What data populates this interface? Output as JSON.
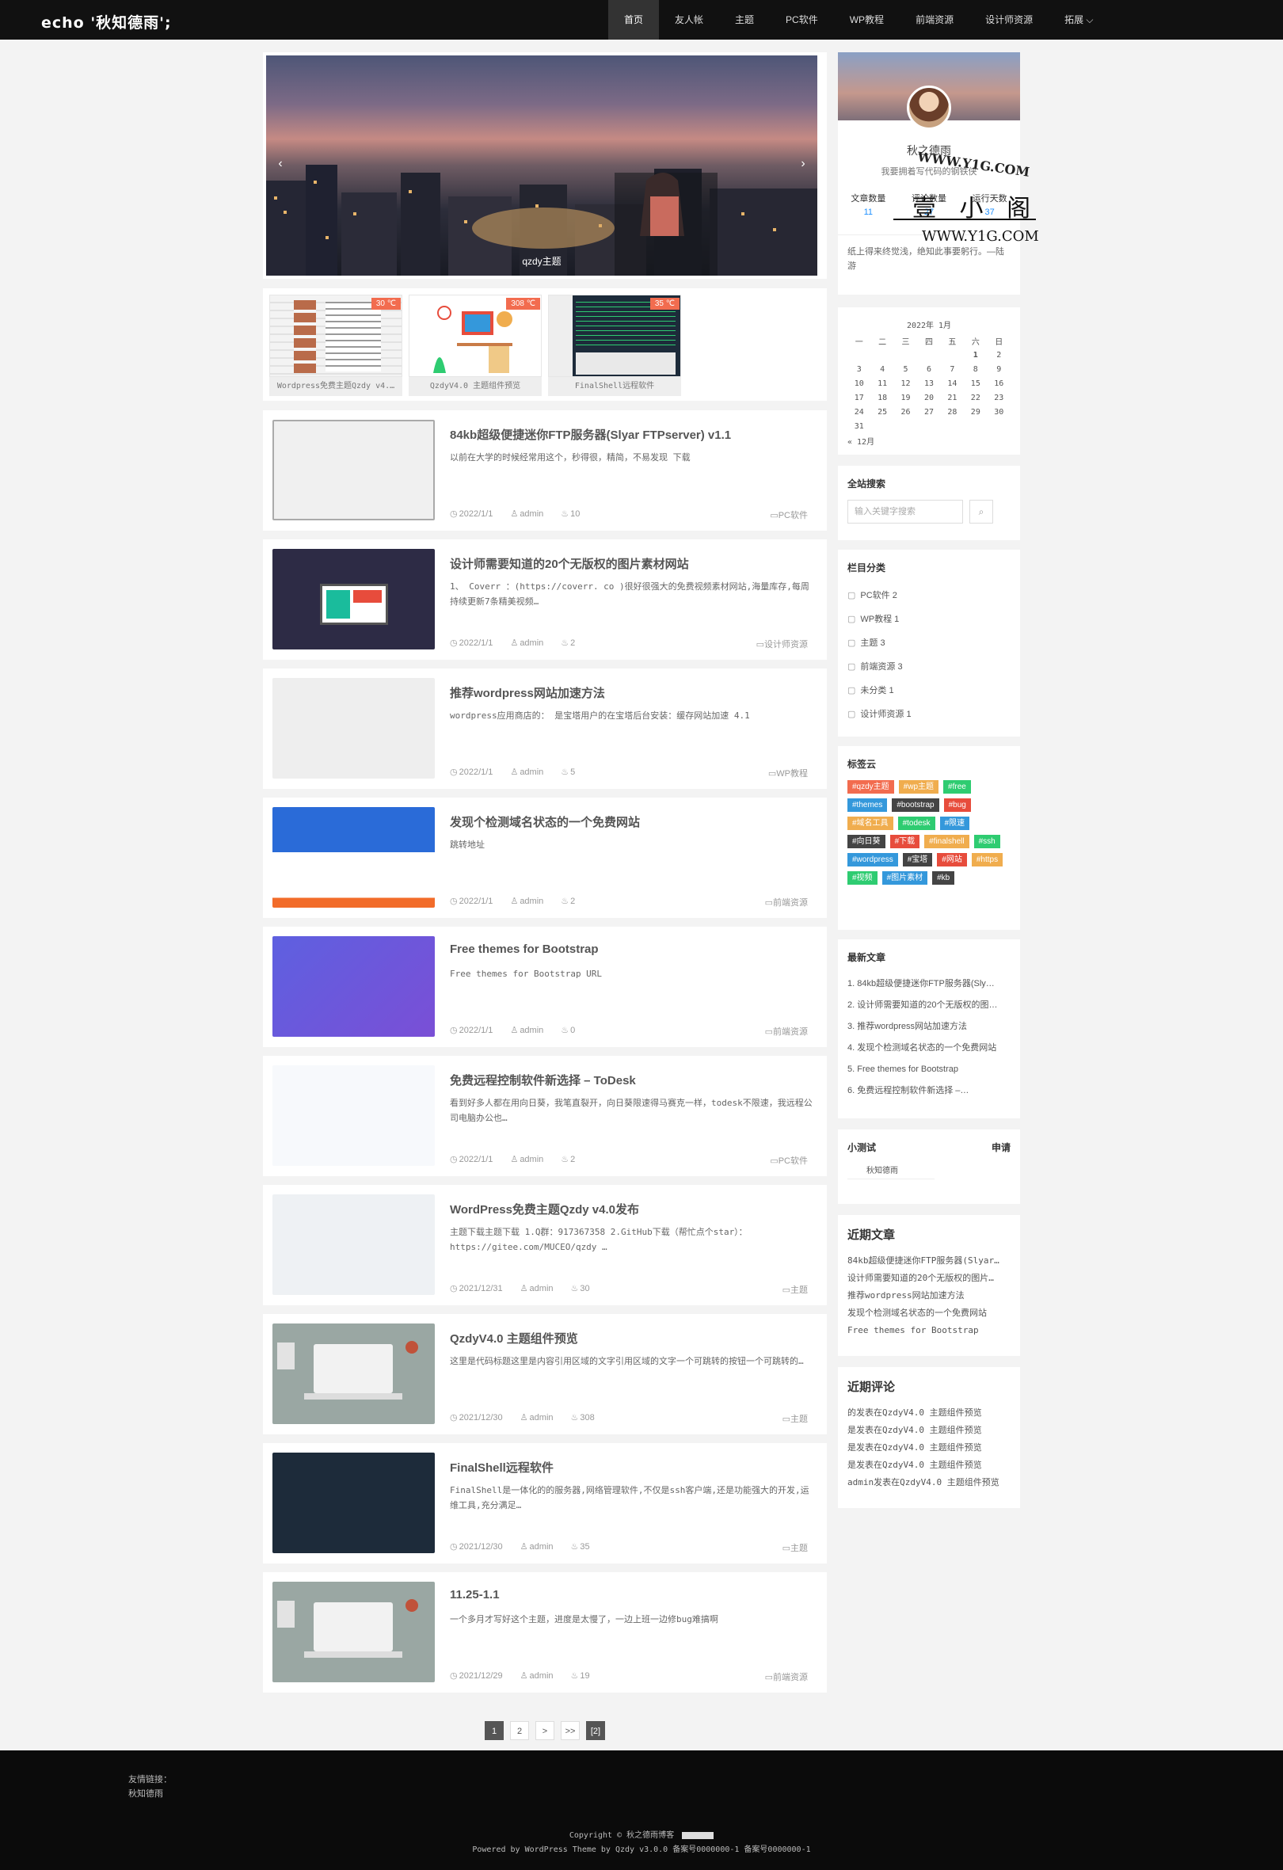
{
  "nav": {
    "logo": "echo '秋知德雨';",
    "items": [
      "首页",
      "友人帐",
      "主题",
      "PC软件",
      "WP教程",
      "前端资源",
      "设计师资源",
      "拓展 ⌵"
    ]
  },
  "slider": {
    "caption": "qzdy主题",
    "prev": "‹",
    "next": "›"
  },
  "thumbs": [
    {
      "label": "Wordpress免费主题Qzdy v4.…",
      "temp": "30 ℃"
    },
    {
      "label": "QzdyV4.0 主题组件预览",
      "temp": "308 ℃"
    },
    {
      "label": "FinalShell远程软件",
      "temp": "35 ℃"
    }
  ],
  "posts": [
    {
      "title": "84kb超级便捷迷你FTP服务器(Slyar FTPserver) v1.1",
      "excerpt": "以前在大学的时候经常用这个，秒得很，精简，不易发现  下载",
      "date": "2022/1/1",
      "author": "admin",
      "views": "10",
      "cat": "PC软件"
    },
    {
      "title": "设计师需要知道的20个无版权的图片素材网站",
      "excerpt": "1、 Coverr ：(https://coverr. co )很好很强大的免费视频素材网站,海量库存,每周持续更新7条精美视频…",
      "date": "2022/1/1",
      "author": "admin",
      "views": "2",
      "cat": "设计师资源"
    },
    {
      "title": "推荐wordpress网站加速方法",
      "excerpt": "wordpress应用商店的：   是宝塔用户的在宝塔后台安装：缓存网站加速 4.1",
      "date": "2022/1/1",
      "author": "admin",
      "views": "5",
      "cat": "WP教程"
    },
    {
      "title": "发现个检测域名状态的一个免费网站",
      "excerpt": "跳转地址",
      "date": "2022/1/1",
      "author": "admin",
      "views": "2",
      "cat": "前端资源"
    },
    {
      "title": "Free themes for Bootstrap",
      "excerpt": "Free themes for Bootstrap URL",
      "date": "2022/1/1",
      "author": "admin",
      "views": "0",
      "cat": "前端资源"
    },
    {
      "title": "免费远程控制软件新选择 – ToDesk",
      "excerpt": "看到好多人都在用向日葵，我笔直裂开，向日葵限速得马赛克一样，todesk不限速，我远程公司电脑办公也…",
      "date": "2022/1/1",
      "author": "admin",
      "views": "2",
      "cat": "PC软件"
    },
    {
      "title": "WordPress免费主题Qzdy v4.0发布",
      "excerpt": "主题下载主题下载 1.Q群：917367358 2.GitHub下载（帮忙点个star）：https://gitee.com/MUCEO/qzdy …",
      "date": "2021/12/31",
      "author": "admin",
      "views": "30",
      "cat": "主题"
    },
    {
      "title": "QzdyV4.0 主题组件预览",
      "excerpt": "这里是代码标题这里是内容引用区域的文字引用区域的文字一个可跳转的按钮一个可跳转的…",
      "date": "2021/12/30",
      "author": "admin",
      "views": "308",
      "cat": "主题"
    },
    {
      "title": "FinalShell远程软件",
      "excerpt": "FinalShell是一体化的的服务器,网络管理软件,不仅是ssh客户端,还是功能强大的开发,运维工具,充分满足…",
      "date": "2021/12/30",
      "author": "admin",
      "views": "35",
      "cat": "主题"
    },
    {
      "title": "11.25-1.1",
      "excerpt": "一个多月才写好这个主题，进度是太慢了，一边上班一边修bug难搞啊",
      "date": "2021/12/29",
      "author": "admin",
      "views": "19",
      "cat": "前端资源"
    }
  ],
  "pager": [
    "1",
    "2",
    ">",
    ">>",
    "[2]"
  ],
  "profile": {
    "name": "秋之德雨",
    "desc": "我要拥着写代码的钢铁侠",
    "stats": [
      {
        "label": "文章数量",
        "value": "11"
      },
      {
        "label": "评论数量",
        "value": "27"
      },
      {
        "label": "运行天数",
        "value": "37"
      }
    ]
  },
  "quote": "纸上得来终觉浅，绝知此事要躬行。—陆游",
  "calendar": {
    "caption": "2022年 1月",
    "head": [
      "一",
      "二",
      "三",
      "四",
      "五",
      "六",
      "日"
    ],
    "rows": [
      [
        "",
        "",
        "",
        "",
        "",
        "1",
        "2"
      ],
      [
        "3",
        "4",
        "5",
        "6",
        "7",
        "8",
        "9"
      ],
      [
        "10",
        "11",
        "12",
        "13",
        "14",
        "15",
        "16"
      ],
      [
        "17",
        "18",
        "19",
        "20",
        "21",
        "22",
        "23"
      ],
      [
        "24",
        "25",
        "26",
        "27",
        "28",
        "29",
        "30"
      ],
      [
        "31",
        "",
        "",
        "",
        "",
        "",
        ""
      ]
    ],
    "prev": "« 12月"
  },
  "search": {
    "title": "全站搜索",
    "placeholder": "输入关键字搜索",
    "btn": "⌕"
  },
  "categories": {
    "title": "栏目分类",
    "items": [
      "PC软件 2",
      "WP教程 1",
      "主题 3",
      "前端资源 3",
      "未分类 1",
      "设计师资源 1"
    ]
  },
  "tagcloud": {
    "title": "标签云",
    "tags": [
      {
        "t": "#qzdy主题",
        "c": "#f26c4f"
      },
      {
        "t": "#wp主题",
        "c": "#f0ad4e"
      },
      {
        "t": "#free",
        "c": "#2ecc71"
      },
      {
        "t": "#themes",
        "c": "#3498db"
      },
      {
        "t": "#bootstrap",
        "c": "#444444"
      },
      {
        "t": "#bug",
        "c": "#e74c3c"
      },
      {
        "t": "#域名工具",
        "c": "#f0ad4e"
      },
      {
        "t": "#todesk",
        "c": "#2ecc71"
      },
      {
        "t": "#限速",
        "c": "#3498db"
      },
      {
        "t": "#向日葵",
        "c": "#444444"
      },
      {
        "t": "#下载",
        "c": "#e74c3c"
      },
      {
        "t": "#finalshell",
        "c": "#f0ad4e"
      },
      {
        "t": "#ssh",
        "c": "#2ecc71"
      },
      {
        "t": "#wordpress",
        "c": "#3498db"
      },
      {
        "t": "#宝塔",
        "c": "#444444"
      },
      {
        "t": "#网站",
        "c": "#e74c3c"
      },
      {
        "t": "#https",
        "c": "#f0ad4e"
      },
      {
        "t": "#视频",
        "c": "#2ecc71"
      },
      {
        "t": "#图片素材",
        "c": "#3498db"
      },
      {
        "t": "#kb",
        "c": "#444444"
      }
    ]
  },
  "latest": {
    "title": "最新文章",
    "items": [
      "1. 84kb超级便捷迷你FTP服务器(Sly…",
      "2. 设计师需要知道的20个无版权的图…",
      "3. 推荐wordpress网站加速方法",
      "4. 发现个检测域名状态的一个免费网站",
      "5. Free themes for Bootstrap",
      "6. 免费远程控制软件新选择 –…"
    ]
  },
  "test": {
    "title": "小测试",
    "action": "申请",
    "item": "秋知德雨"
  },
  "recent_posts": {
    "title": "近期文章",
    "items": [
      "84kb超级便捷迷你FTP服务器(Slyar…",
      "设计师需要知道的20个无版权的图片…",
      "推荐wordpress网站加速方法",
      "发现个检测域名状态的一个免费网站",
      "Free themes for Bootstrap"
    ]
  },
  "recent_comments": {
    "title": "近期评论",
    "items": [
      "的发表在QzdyV4.0 主题组件预览",
      "是发表在QzdyV4.0 主题组件预览",
      "是发表在QzdyV4.0 主题组件预览",
      "是发表在QzdyV4.0 主题组件预览",
      "admin发表在QzdyV4.0 主题组件预览"
    ]
  },
  "watermark": {
    "top": "WWW.Y1G.COM",
    "mid": "壹 小 阁",
    "bottom": "WWW.Y1G.COM"
  },
  "footer": {
    "links_label": "友情链接：",
    "link": "秋知德雨",
    "copy": "Copyright © 秋之德雨博客",
    "powered": "Powered by WordPress Theme by Qzdy v3.0.0 备案号0000000-1 备案号0000000-1"
  }
}
